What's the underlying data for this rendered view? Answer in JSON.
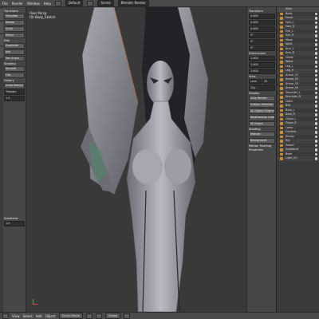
{
  "topbar": {
    "menus": [
      "File",
      "Render",
      "Window",
      "Help"
    ],
    "screen": "Default",
    "scene": "Scene",
    "engine": "Blender Render"
  },
  "toolshelf": {
    "transform_header": "Transform",
    "buttons": [
      "Translate",
      "Rotate",
      "Scale",
      "Mirror"
    ],
    "edit_header": "Edit",
    "edit_buttons": [
      "Duplicate",
      "Join",
      "Set Origin"
    ],
    "shading_header": "Shading",
    "shading_buttons": [
      "Smooth",
      "Flat"
    ],
    "history_header": "History",
    "operator_header": "Undo History",
    "field_label": "Triangle",
    "field_value": "1.0",
    "bottom_label": "Subdivide"
  },
  "viewport": {
    "label_line1": "User Persp",
    "label_line2": "(0) Body_Sketch"
  },
  "npanel": {
    "transform_header": "Transform",
    "location": [
      "0.000",
      "0.000",
      "0.000"
    ],
    "rotation": [
      "0°",
      "0°",
      "0°"
    ],
    "scale": [
      "1.000",
      "1.000",
      "1.000"
    ],
    "dimensions_header": "Dimensions",
    "view_header": "View",
    "lens_label": "Lens",
    "lens_value": "35",
    "clip_label": "Clip",
    "display_header": "Display",
    "display_items": [
      "Only Render",
      "Outline Selected",
      "All Object Origins",
      "Relationship Lines",
      "All Edges"
    ],
    "shading_header": "Shading",
    "matcap_label": "Matcap",
    "background_label": "Background",
    "motion_header": "Motion Tracking",
    "properties_header": "Properties"
  },
  "outliner": {
    "header": "View",
    "items": [
      "Body",
      "Head",
      "Hair_L",
      "Hair_R",
      "Eye_L",
      "Eye_R",
      "Mask",
      "Neck",
      "Arm_L",
      "Arm_R",
      "Chest",
      "Waist",
      "Leg_L",
      "Leg_R",
      "Armor_01",
      "Armor_02",
      "Armor_03",
      "Armor_04",
      "Shoulder_L",
      "Shoulder_R",
      "Cloth",
      "Belt",
      "Boot_L",
      "Boot_R",
      "Glove_L",
      "Glove_R",
      "Lamp",
      "Camera",
      "Empty",
      "Rig",
      "Sword",
      "Scabbard",
      "Base",
      "Light_02"
    ]
  },
  "bottombar": {
    "view": "View",
    "select": "Select",
    "add": "Add",
    "object": "Object",
    "mode": "Sculpt Mode",
    "global": "Global"
  }
}
